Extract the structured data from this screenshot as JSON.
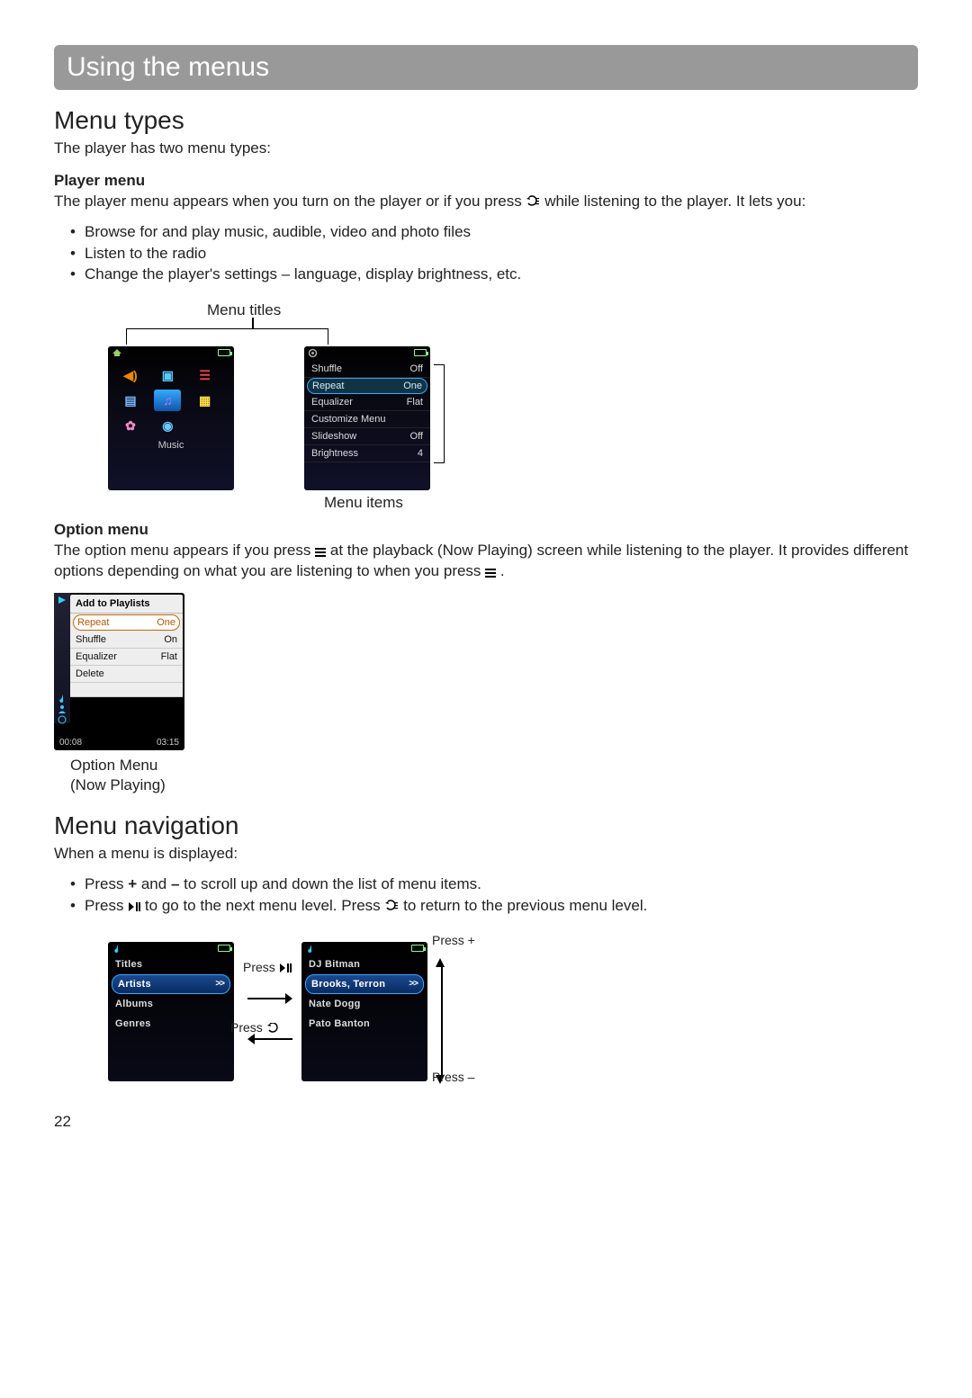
{
  "title_bar": "Using the menus",
  "section1": {
    "heading": "Menu types",
    "intro": "The player has two menu types:",
    "player_menu": {
      "heading": "Player menu",
      "text1": "The player menu appears when you turn on the player or if you press ",
      "text2": " while listening to the player. It lets you:",
      "bullets": [
        "Browse for and play music, audible, video and photo files",
        "Listen to the radio",
        "Change the player's settings – language, display brightness, etc."
      ]
    },
    "diag_labels": {
      "menu_titles": "Menu titles",
      "menu_items": "Menu items"
    },
    "screen1_footer": "Music",
    "screen2_rows": [
      {
        "label": "Shuffle",
        "value": "Off",
        "sel": false
      },
      {
        "label": "Repeat",
        "value": "One",
        "sel": true
      },
      {
        "label": "Equalizer",
        "value": "Flat",
        "sel": false
      },
      {
        "label": "Customize Menu",
        "value": "",
        "sel": false
      },
      {
        "label": "Slideshow",
        "value": "Off",
        "sel": false
      },
      {
        "label": "Brightness",
        "value": "4",
        "sel": false
      }
    ],
    "option_menu": {
      "heading": "Option menu",
      "text1": "The option menu appears if you press ",
      "text2": " at the playback (Now Playing) screen while listening to the player. It provides different options depending on what you are listening to when you press ",
      "text3": " ."
    },
    "opt_screen": {
      "header": "Add to Playlists",
      "rows": [
        {
          "label": "Repeat",
          "value": "One",
          "sel": true
        },
        {
          "label": "Shuffle",
          "value": "On",
          "sel": false
        },
        {
          "label": "Equalizer",
          "value": "Flat",
          "sel": false
        },
        {
          "label": "Delete",
          "value": "",
          "sel": false
        }
      ],
      "time_left": "00:08",
      "time_right": "03:15",
      "caption1": "Option Menu",
      "caption2": "(Now Playing)"
    }
  },
  "section2": {
    "heading": "Menu navigation",
    "intro": "When a menu is displayed:",
    "bullets_html": {
      "b1a": "Press ",
      "b1b": " and ",
      "b1c": " to scroll up and down the list of menu items.",
      "b2a": "Press ",
      "b2b": " to go to the next menu level. Press ",
      "b2c": " to return to the previous menu level."
    },
    "plus": "+",
    "minus": "–",
    "nav_screen1": [
      "Titles",
      "Artists",
      "Albums",
      "Genres"
    ],
    "nav_screen2": [
      "DJ Bitman",
      "Brooks, Terron",
      "Nate Dogg",
      "Pato Banton"
    ],
    "press_labels": {
      "play": "Press",
      "back": "Press",
      "plus": "Press +",
      "minus": "Press –"
    }
  },
  "page_number": "22"
}
